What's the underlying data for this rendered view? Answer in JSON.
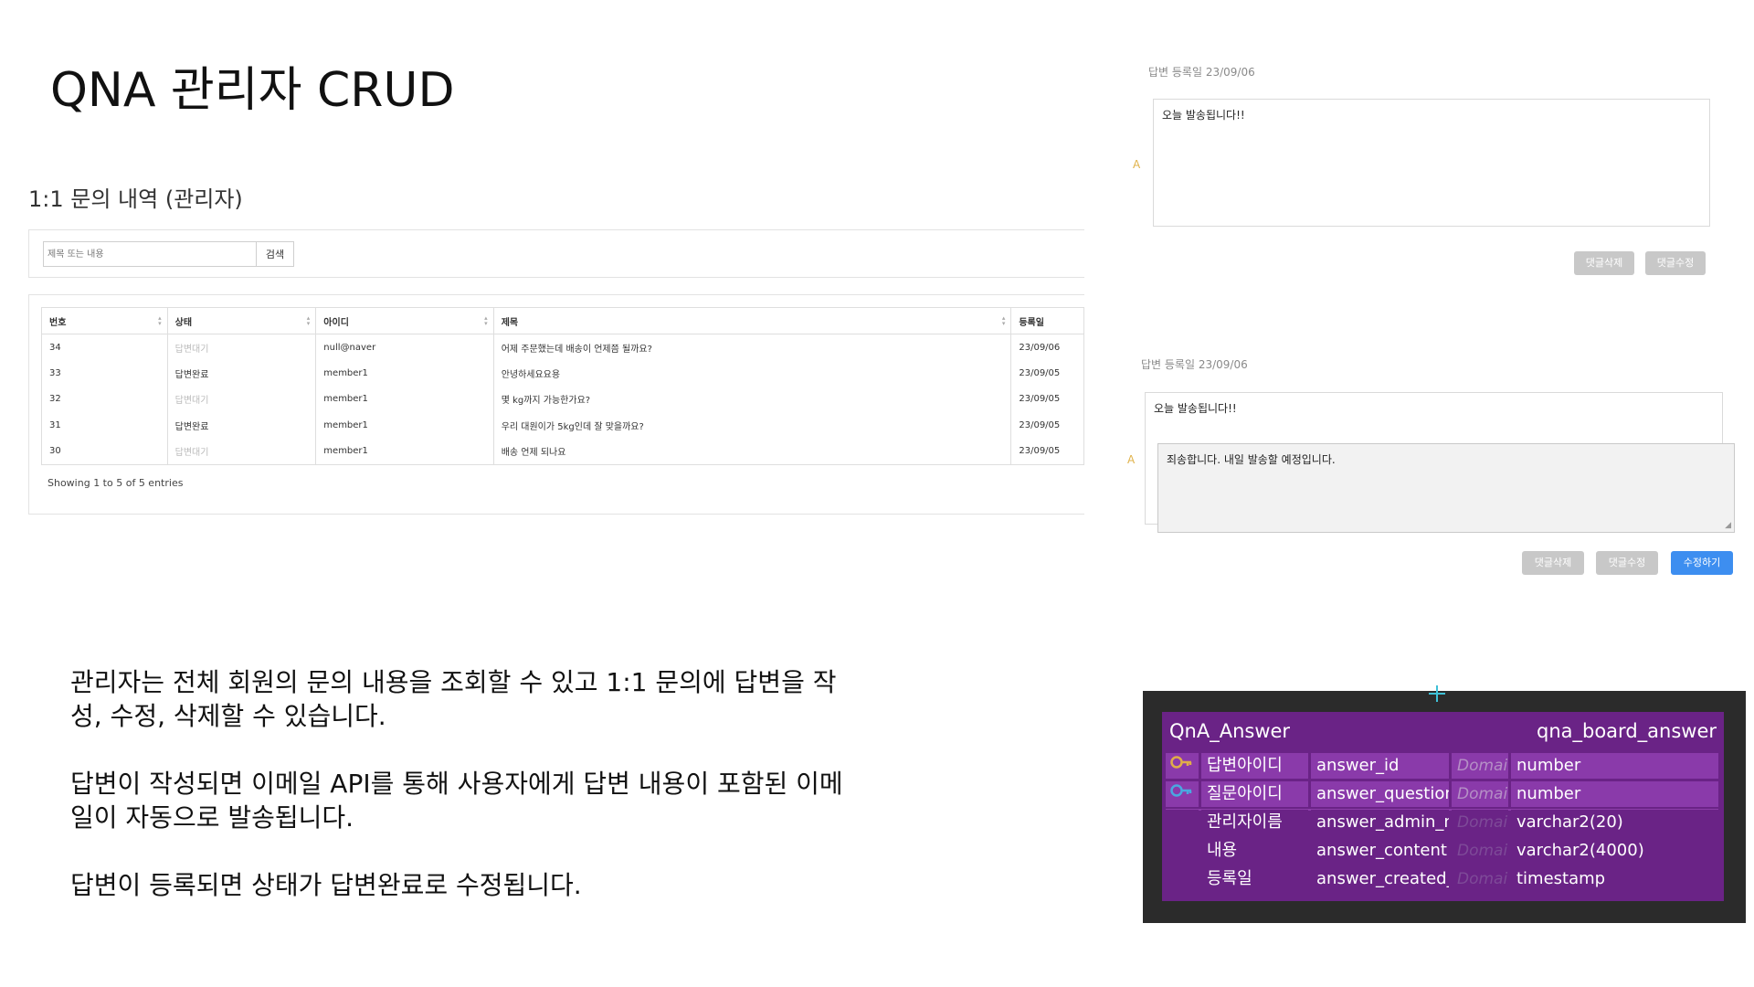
{
  "slide": {
    "title": "QNA 관리자 CRUD"
  },
  "list_panel": {
    "heading": "1:1 문의 내역 (관리자)",
    "search_placeholder": "제목 또는 내용",
    "search_button": "검색",
    "columns": [
      "번호",
      "상태",
      "아이디",
      "제목",
      "등록일"
    ],
    "rows": [
      {
        "no": "34",
        "status": "답변대기",
        "id": "null@naver",
        "title": "어제 주문했는데 배송이 언제쯤 될까요?",
        "date": "23/09/06"
      },
      {
        "no": "33",
        "status": "답변완료",
        "id": "member1",
        "title": "안녕하세요요용",
        "date": "23/09/05"
      },
      {
        "no": "32",
        "status": "답변대기",
        "id": "member1",
        "title": "몇 kg까지 가능한가요?",
        "date": "23/09/05"
      },
      {
        "no": "31",
        "status": "답변완료",
        "id": "member1",
        "title": "우리 대원이가 5kg인데 잘 맞을까요?",
        "date": "23/09/05"
      },
      {
        "no": "30",
        "status": "답변대기",
        "id": "member1",
        "title": "배송 언제 되나요",
        "date": "23/09/05"
      }
    ],
    "footer": "Showing 1 to 5 of 5 entries"
  },
  "description": {
    "para1": "관리자는 전체 회원의 문의 내용을 조회할 수 있고 1:1 문의에 답변을 작성, 수정, 삭제할 수 있습니다.",
    "para2": "답변이 작성되면 이메일 API를 통해 사용자에게 답변 내용이 포함된 이메일이 자동으로 발송됩니다.",
    "para3": "답변이 등록되면 상태가 답변완료로 수정됩니다."
  },
  "answer_view": {
    "date_label": "답변 등록일 23/09/06",
    "a_marker": "A",
    "content": "오늘 발송됩니다!!",
    "delete_button": "댓글삭제",
    "edit_button": "댓글수정"
  },
  "answer_edit": {
    "date_label": "답변 등록일 23/09/06",
    "a_marker": "A",
    "original_content": "오늘 발송됩니다!!",
    "edit_content": "죄송합니다. 내일 발송할 예정입니다.",
    "delete_button": "댓글삭제",
    "edit_button": "댓글수정",
    "submit_button": "수정하기"
  },
  "erd": {
    "entity_name": "QnA_Answer",
    "table_name": "qna_board_answer",
    "columns": [
      {
        "logical": "답변아이디",
        "physical": "answer_id",
        "domain": "Domain",
        "type": "number",
        "key": "pk"
      },
      {
        "logical": "질문아이디",
        "physical": "answer_question_id",
        "domain": "Domain",
        "type": "number",
        "key": "fk"
      },
      {
        "logical": "관리자이름",
        "physical": "answer_admin_name",
        "domain": "Domain",
        "type": "varchar2(20)",
        "key": ""
      },
      {
        "logical": "내용",
        "physical": "answer_content",
        "domain": "Domain",
        "type": "varchar2(4000)",
        "key": ""
      },
      {
        "logical": "등록일",
        "physical": "answer_created_at",
        "domain": "Domain",
        "type": "timestamp",
        "key": ""
      }
    ],
    "colors": {
      "background": "#2b2b2b",
      "entity": "#6a2386",
      "cell": "#8a3aaa",
      "pk_key": "#d9a640",
      "fk_key": "#4aa8e0"
    }
  }
}
